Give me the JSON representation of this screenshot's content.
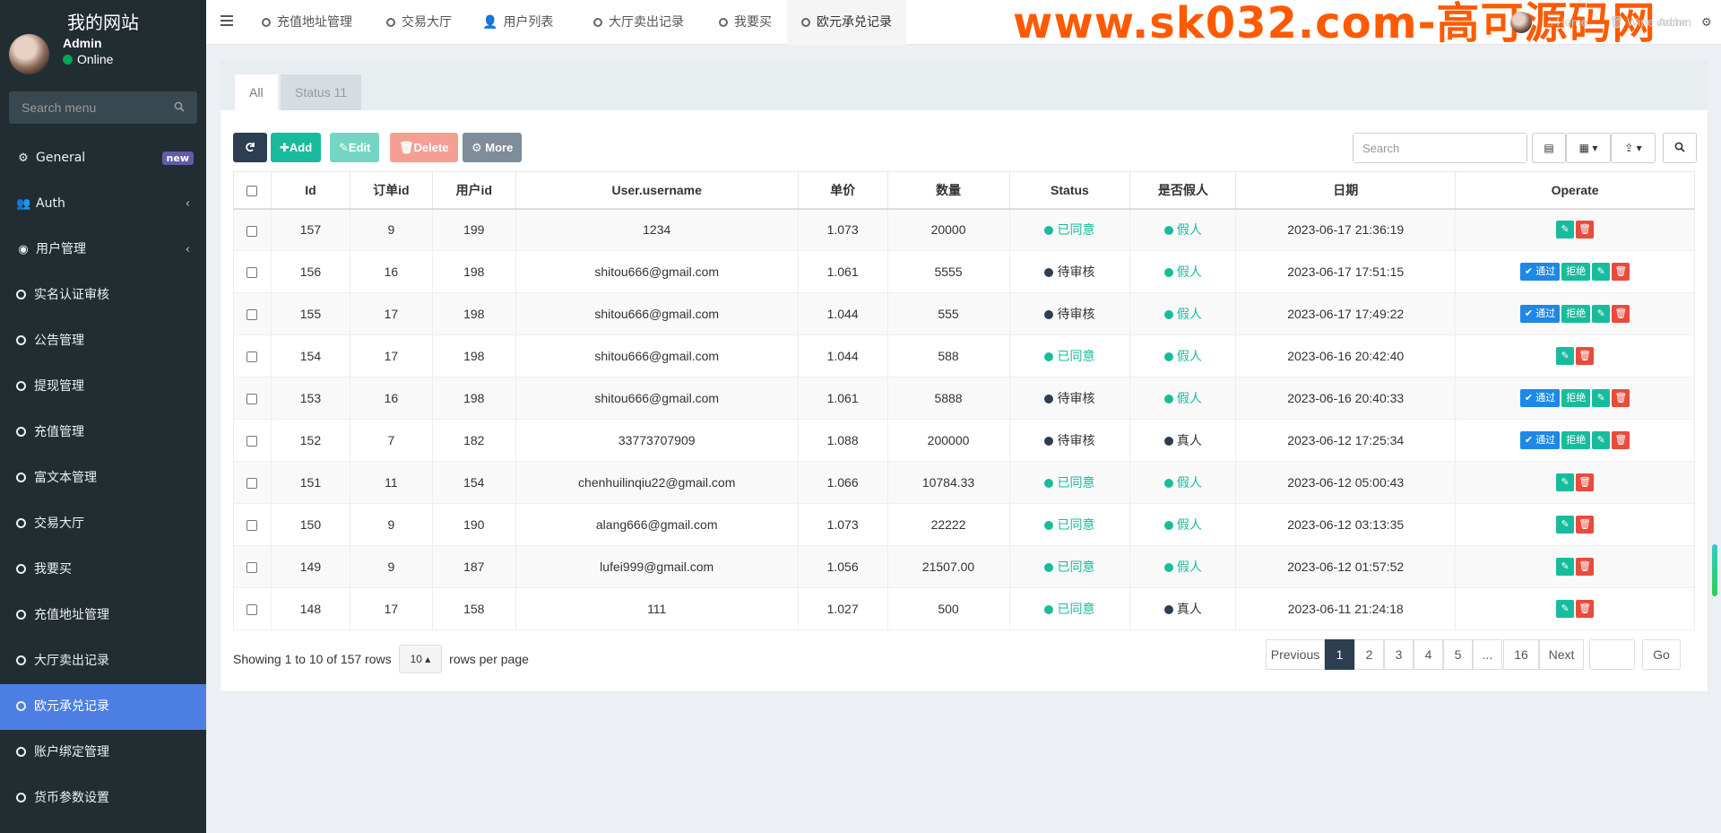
{
  "brand": {
    "site_title": "我的网站"
  },
  "user": {
    "name": "Admin",
    "status": "Online"
  },
  "side_search": {
    "placeholder": "Search menu"
  },
  "menu": [
    {
      "label": "General",
      "icon": "cogs-icon",
      "badge": "new"
    },
    {
      "label": "Auth",
      "icon": "group-icon",
      "chevron": "‹"
    },
    {
      "label": "用户管理",
      "icon": "user-circle-icon",
      "chevron": "‹"
    },
    {
      "label": "实名认证审核",
      "icon": "circle-icon"
    },
    {
      "label": "公告管理",
      "icon": "circle-icon"
    },
    {
      "label": "提现管理",
      "icon": "circle-icon"
    },
    {
      "label": "充值管理",
      "icon": "circle-icon"
    },
    {
      "label": "富文本管理",
      "icon": "circle-icon"
    },
    {
      "label": "交易大厅",
      "icon": "circle-icon"
    },
    {
      "label": "我要买",
      "icon": "circle-icon"
    },
    {
      "label": "充值地址管理",
      "icon": "circle-icon"
    },
    {
      "label": "大厅卖出记录",
      "icon": "circle-icon"
    },
    {
      "label": "欧元承兑记录",
      "icon": "circle-icon",
      "active": true
    },
    {
      "label": "账户绑定管理",
      "icon": "circle-icon"
    },
    {
      "label": "货币参数设置",
      "icon": "circle-icon"
    }
  ],
  "top_tabs": [
    "充值地址管理",
    "交易大厅",
    "用户列表",
    "大厅卖出记录",
    "我要买",
    "欧元承兑记录"
  ],
  "top_right": {
    "home": "Home",
    "wipe": "Wipe cache",
    "admin": "Admin"
  },
  "watermark": "www.sk032.com-高可源码网",
  "panel_tabs": {
    "all": "All",
    "status": "Status 11"
  },
  "toolbar": {
    "add": "Add",
    "edit": "Edit",
    "delete": "Delete",
    "more": "More"
  },
  "table_search": {
    "placeholder": "Search"
  },
  "columns": [
    "Id",
    "订单id",
    "用户id",
    "User.username",
    "单价",
    "数量",
    "Status",
    "是否假人",
    "日期",
    "Operate"
  ],
  "rows": [
    {
      "id": "157",
      "order": "9",
      "uid": "199",
      "username": "1234",
      "price": "1.073",
      "qty": "20000",
      "status": "已同意",
      "fake": "假人",
      "date": "2023-06-17 21:36:19",
      "pending": false
    },
    {
      "id": "156",
      "order": "16",
      "uid": "198",
      "username": "shitou666@gmail.com",
      "price": "1.061",
      "qty": "5555",
      "status": "待审核",
      "fake": "假人",
      "date": "2023-06-17 17:51:15",
      "pending": true
    },
    {
      "id": "155",
      "order": "17",
      "uid": "198",
      "username": "shitou666@gmail.com",
      "price": "1.044",
      "qty": "555",
      "status": "待审核",
      "fake": "假人",
      "date": "2023-06-17 17:49:22",
      "pending": true
    },
    {
      "id": "154",
      "order": "17",
      "uid": "198",
      "username": "shitou666@gmail.com",
      "price": "1.044",
      "qty": "588",
      "status": "已同意",
      "fake": "假人",
      "date": "2023-06-16 20:42:40",
      "pending": false
    },
    {
      "id": "153",
      "order": "16",
      "uid": "198",
      "username": "shitou666@gmail.com",
      "price": "1.061",
      "qty": "5888",
      "status": "待审核",
      "fake": "假人",
      "date": "2023-06-16 20:40:33",
      "pending": true
    },
    {
      "id": "152",
      "order": "7",
      "uid": "182",
      "username": "33773707909",
      "price": "1.088",
      "qty": "200000",
      "status": "待审核",
      "fake": "真人",
      "date": "2023-06-12 17:25:34",
      "pending": true
    },
    {
      "id": "151",
      "order": "11",
      "uid": "154",
      "username": "chenhuilinqiu22@gmail.com",
      "price": "1.066",
      "qty": "10784.33",
      "status": "已同意",
      "fake": "假人",
      "date": "2023-06-12 05:00:43",
      "pending": false
    },
    {
      "id": "150",
      "order": "9",
      "uid": "190",
      "username": "alang666@gmail.com",
      "price": "1.073",
      "qty": "22222",
      "status": "已同意",
      "fake": "假人",
      "date": "2023-06-12 03:13:35",
      "pending": false
    },
    {
      "id": "149",
      "order": "9",
      "uid": "187",
      "username": "lufei999@gmail.com",
      "price": "1.056",
      "qty": "21507.00",
      "status": "已同意",
      "fake": "假人",
      "date": "2023-06-12 01:57:52",
      "pending": false
    },
    {
      "id": "148",
      "order": "17",
      "uid": "158",
      "username": "111",
      "price": "1.027",
      "qty": "500",
      "status": "已同意",
      "fake": "真人",
      "date": "2023-06-11 21:24:18",
      "pending": false
    }
  ],
  "actions": {
    "pass": "通过",
    "reject": "拒绝"
  },
  "colors": {
    "approved": "#18bc9c",
    "pending": "#2c3e50",
    "fake": "#18bc9c",
    "real": "#2c3e50"
  },
  "pagination": {
    "showing_text": "Showing 1 to 10 of 157 rows",
    "page_size": "10",
    "per_page_text": "rows per page",
    "previous": "Previous",
    "pages": [
      "1",
      "2",
      "3",
      "4",
      "5",
      "...",
      "16"
    ],
    "current": "1",
    "next": "Next",
    "go": "Go"
  }
}
